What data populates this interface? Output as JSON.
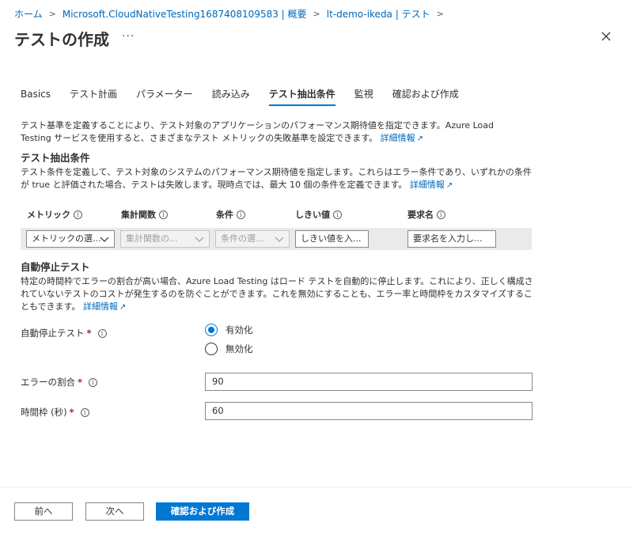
{
  "breadcrumb": {
    "items": [
      "ホーム",
      "Microsoft.CloudNativeTesting1687408109583 | 概要",
      "lt-demo-ikeda | テスト"
    ],
    "separator": ">"
  },
  "header": {
    "title": "テストの作成",
    "more": "···",
    "close_icon": "close-icon"
  },
  "tabs": [
    {
      "label": "Basics",
      "active": false
    },
    {
      "label": "テスト計画",
      "active": false
    },
    {
      "label": "パラメーター",
      "active": false
    },
    {
      "label": "読み込み",
      "active": false
    },
    {
      "label": "テスト抽出条件",
      "active": true
    },
    {
      "label": "監視",
      "active": false
    },
    {
      "label": "確認および作成",
      "active": false
    }
  ],
  "intro": {
    "text": "テスト基準を定義することにより、テスト対象のアプリケーションのパフォーマンス期待値を指定できます。Azure Load Testing サービスを使用すると、さまざまなテスト メトリックの失敗基準を設定できます。",
    "link": "詳細情報"
  },
  "criteria": {
    "heading": "テスト抽出条件",
    "text": "テスト条件を定義して、テスト対象のシステムのパフォーマンス期待値を指定します。これらはエラー条件であり、いずれかの条件が true と評価された場合、テストは失敗します。現時点では、最大 10 個の条件を定義できます。",
    "link": "詳細情報",
    "columns": [
      "メトリック",
      "集計関数",
      "条件",
      "しきい値",
      "要求名"
    ],
    "row": {
      "metric_placeholder": "メトリックの選...",
      "aggregate_placeholder": "集計関数の...",
      "condition_placeholder": "条件の選...",
      "threshold_placeholder": "しきい値を入...",
      "request_placeholder": "要求名を入力し..."
    }
  },
  "autostop": {
    "heading": "自動停止テスト",
    "text": "特定の時間枠でエラーの割合が高い場合、Azure Load Testing はロード テストを自動的に停止します。これにより、正しく構成されていないテストのコストが発生するのを防ぐことができます。これを無効にすることも、エラー率と時間枠をカスタマイズすることもできます。",
    "link": "詳細情報",
    "toggle_label": "自動停止テスト",
    "options": [
      {
        "label": "有効化",
        "selected": true
      },
      {
        "label": "無効化",
        "selected": false
      }
    ],
    "error_rate_label": "エラーの割合",
    "error_rate_value": "90",
    "time_window_label": "時間枠 (秒)",
    "time_window_value": "60"
  },
  "footer": {
    "prev": "前へ",
    "next": "次へ",
    "create": "確認および作成"
  },
  "colors": {
    "accent": "#0078d4",
    "link": "#0067b8",
    "required": "#a4262c"
  }
}
